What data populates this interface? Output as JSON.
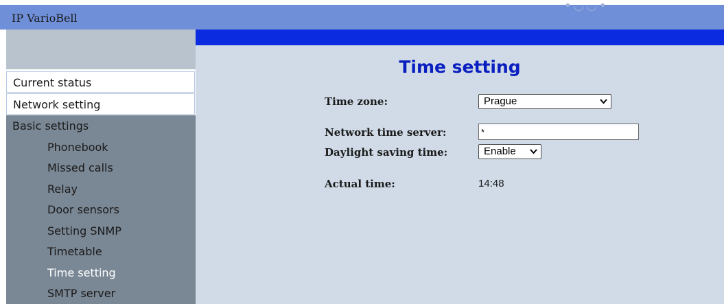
{
  "header": {
    "app_title": "IP VarioBell",
    "logo_fragment": "•◡◡•"
  },
  "nav": {
    "current_status": "Current status",
    "network_setting": "Network setting",
    "basic_settings": {
      "label": "Basic settings",
      "items": [
        {
          "label": "Phonebook"
        },
        {
          "label": "Missed calls"
        },
        {
          "label": "Relay"
        },
        {
          "label": "Door sensors"
        },
        {
          "label": "Setting SNMP"
        },
        {
          "label": "Timetable"
        },
        {
          "label": "Time setting"
        },
        {
          "label": "SMTP server"
        }
      ],
      "active_index": 6
    }
  },
  "main": {
    "title": "Time setting",
    "form": {
      "time_zone": {
        "label": "Time zone:",
        "value": "Prague"
      },
      "ntp_server": {
        "label": "Network time server:",
        "value": "*"
      },
      "dst": {
        "label": "Daylight saving time:",
        "value": "Enable"
      },
      "actual_time": {
        "label": "Actual time:",
        "value": "14:48"
      }
    }
  },
  "colors": {
    "topbar": "#6f8fd9",
    "main_strip": "#0a2bdf",
    "main_bg": "#d0dbe7",
    "submenu_bg": "#7a8794",
    "title": "#0a1fbf"
  }
}
